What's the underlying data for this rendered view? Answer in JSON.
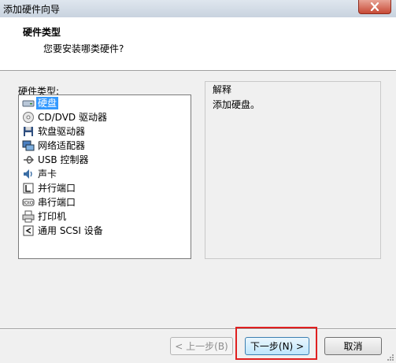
{
  "window": {
    "title": "添加硬件向导"
  },
  "header": {
    "title": "硬件类型",
    "subtitle": "您要安装哪类硬件?"
  },
  "hardware_list": {
    "label": "硬件类型:",
    "selected_index": 0,
    "items": [
      {
        "label": "硬盘",
        "icon": "hard-disk-icon"
      },
      {
        "label": "CD/DVD 驱动器",
        "icon": "cd-dvd-icon"
      },
      {
        "label": "软盘驱动器",
        "icon": "floppy-icon"
      },
      {
        "label": "网络适配器",
        "icon": "network-adapter-icon"
      },
      {
        "label": "USB 控制器",
        "icon": "usb-icon"
      },
      {
        "label": "声卡",
        "icon": "sound-icon"
      },
      {
        "label": "并行端口",
        "icon": "parallel-port-icon"
      },
      {
        "label": "串行端口",
        "icon": "serial-port-icon"
      },
      {
        "label": "打印机",
        "icon": "printer-icon"
      },
      {
        "label": "通用 SCSI 设备",
        "icon": "scsi-icon"
      }
    ]
  },
  "explanation": {
    "title": "解释",
    "text": "添加硬盘。"
  },
  "buttons": {
    "back": "< 上一步(B)",
    "next": "下一步(N) >",
    "cancel": "取消"
  }
}
